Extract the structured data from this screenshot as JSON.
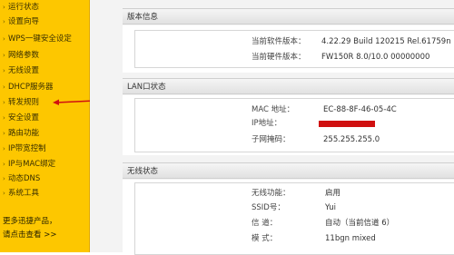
{
  "sidebar": {
    "items": [
      {
        "label": "运行状态"
      },
      {
        "label": "设置向导"
      },
      {
        "label": "WPS一键安全设定"
      },
      {
        "label": "网络参数"
      },
      {
        "label": "无线设置"
      },
      {
        "label": "DHCP服务器"
      },
      {
        "label": "转发规则"
      },
      {
        "label": "安全设置"
      },
      {
        "label": "路由功能"
      },
      {
        "label": "IP带宽控制"
      },
      {
        "label": "IP与MAC绑定"
      },
      {
        "label": "动态DNS"
      },
      {
        "label": "系统工具"
      }
    ],
    "footer_line1": "更多迅捷产品，",
    "footer_line2": "请点击查看 >>",
    "arrow_glyph": "›",
    "accent_color": "#fdc700",
    "annotation_color": "#d01010"
  },
  "version": {
    "header": "版本信息",
    "software_label": "当前软件版本：",
    "software_value": "4.22.29 Build 120215 Rel.61759n",
    "hardware_label": "当前硬件版本：",
    "hardware_value": "FW150R 8.0/10.0 00000000"
  },
  "lan": {
    "header": "LAN口状态",
    "mac_label": "MAC 地址：",
    "mac_value": "EC-88-8F-46-05-4C",
    "ip_label": "IP地址：",
    "mask_label": "子网掩码：",
    "mask_value": "255.255.255.0"
  },
  "wireless": {
    "header": "无线状态",
    "func_label": "无线功能：",
    "func_value": "启用",
    "ssid_label": "SSID号：",
    "ssid_value": "Yui",
    "channel_label": "信 道：",
    "channel_value": "自动（当前信道 6）",
    "mode_label": "模 式：",
    "mode_value": "11bgn mixed"
  }
}
